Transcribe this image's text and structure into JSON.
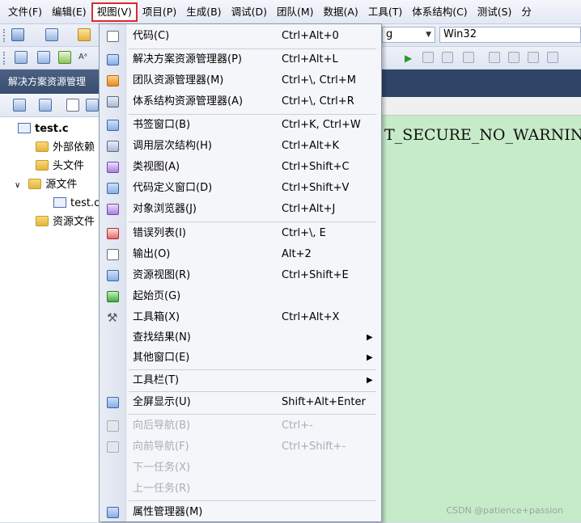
{
  "menubar": {
    "items": [
      "文件(F)",
      "编辑(E)",
      "视图(V)",
      "项目(P)",
      "生成(B)",
      "调试(D)",
      "团队(M)",
      "数据(A)",
      "工具(T)",
      "体系结构(C)",
      "测试(S)",
      "分"
    ]
  },
  "toolbar": {
    "config_value": "g",
    "platform_value": "Win32"
  },
  "solution_explorer": {
    "title": "解决方案资源管理",
    "tree": {
      "project": "test.c",
      "external": "外部依赖",
      "headers": "头文件",
      "sources": "源文件",
      "source_file": "test.c",
      "resources": "资源文件"
    }
  },
  "editor": {
    "code_visible": "T_SECURE_NO_WARNINGS",
    "watermark": "CSDN @patience+passion"
  },
  "view_menu": {
    "items": [
      {
        "label": "代码(C)",
        "shortcut": "Ctrl+Alt+0",
        "icon": "code-icon"
      },
      {
        "label": "解决方案资源管理器(P)",
        "shortcut": "Ctrl+Alt+L",
        "icon": "solution-explorer-icon"
      },
      {
        "label": "团队资源管理器(M)",
        "shortcut": "Ctrl+\\, Ctrl+M",
        "icon": "team-explorer-icon"
      },
      {
        "label": "体系结构资源管理器(A)",
        "shortcut": "Ctrl+\\, Ctrl+R",
        "icon": "architecture-explorer-icon"
      },
      {
        "label": "书签窗口(B)",
        "shortcut": "Ctrl+K, Ctrl+W",
        "icon": "bookmark-icon"
      },
      {
        "label": "调用层次结构(H)",
        "shortcut": "Ctrl+Alt+K",
        "icon": "call-hierarchy-icon"
      },
      {
        "label": "类视图(A)",
        "shortcut": "Ctrl+Shift+C",
        "icon": "class-view-icon"
      },
      {
        "label": "代码定义窗口(D)",
        "shortcut": "Ctrl+Shift+V",
        "icon": "code-definition-icon"
      },
      {
        "label": "对象浏览器(J)",
        "shortcut": "Ctrl+Alt+J",
        "icon": "object-browser-icon"
      },
      {
        "label": "错误列表(I)",
        "shortcut": "Ctrl+\\, E",
        "icon": "error-list-icon"
      },
      {
        "label": "输出(O)",
        "shortcut": "Alt+2",
        "icon": "output-icon"
      },
      {
        "label": "资源视图(R)",
        "shortcut": "Ctrl+Shift+E",
        "icon": "resource-view-icon"
      },
      {
        "label": "起始页(G)",
        "shortcut": "",
        "icon": "start-page-icon"
      },
      {
        "label": "工具箱(X)",
        "shortcut": "Ctrl+Alt+X",
        "icon": "toolbox-icon"
      },
      {
        "label": "查找结果(N)",
        "shortcut": "",
        "icon": ""
      },
      {
        "label": "其他窗口(E)",
        "shortcut": "",
        "icon": ""
      },
      {
        "label": "工具栏(T)",
        "shortcut": "",
        "icon": ""
      },
      {
        "label": "全屏显示(U)",
        "shortcut": "Shift+Alt+Enter",
        "icon": "full-screen-icon"
      },
      {
        "label": "向后导航(B)",
        "shortcut": "Ctrl+-",
        "icon": "navigate-backward-icon"
      },
      {
        "label": "向前导航(F)",
        "shortcut": "Ctrl+Shift+-",
        "icon": "navigate-forward-icon"
      },
      {
        "label": "下一任务(X)",
        "shortcut": "",
        "icon": ""
      },
      {
        "label": "上一任务(R)",
        "shortcut": "",
        "icon": ""
      },
      {
        "label": "属性管理器(M)",
        "shortcut": "",
        "icon": "property-manager-icon"
      }
    ]
  }
}
